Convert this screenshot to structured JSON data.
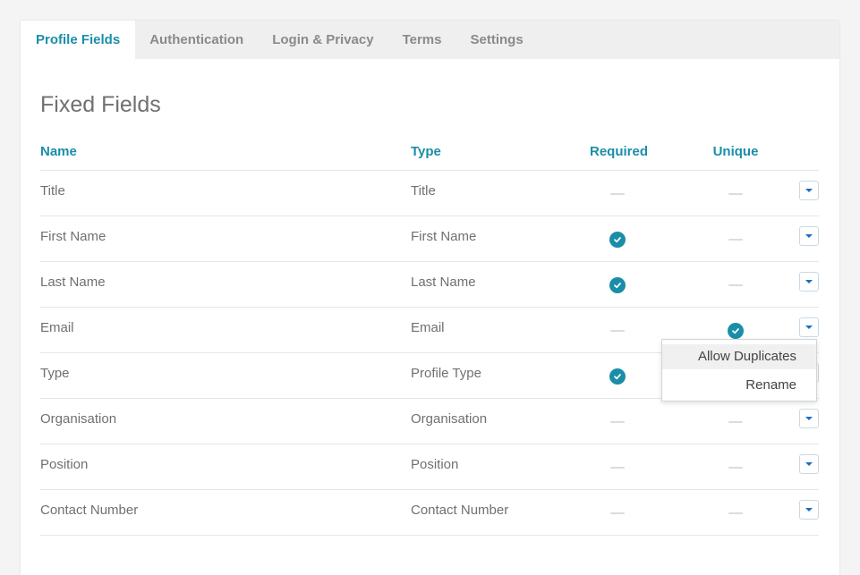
{
  "tabs": [
    {
      "label": "Profile Fields",
      "active": true
    },
    {
      "label": "Authentication",
      "active": false
    },
    {
      "label": "Login & Privacy",
      "active": false
    },
    {
      "label": "Terms",
      "active": false
    },
    {
      "label": "Settings",
      "active": false
    }
  ],
  "section": {
    "title": "Fixed Fields"
  },
  "table": {
    "headers": {
      "name": "Name",
      "type": "Type",
      "required": "Required",
      "unique": "Unique"
    },
    "rows": [
      {
        "name": "Title",
        "type": "Title",
        "required": false,
        "unique": false
      },
      {
        "name": "First Name",
        "type": "First Name",
        "required": true,
        "unique": false
      },
      {
        "name": "Last Name",
        "type": "Last Name",
        "required": true,
        "unique": false
      },
      {
        "name": "Email",
        "type": "Email",
        "required": false,
        "unique": true
      },
      {
        "name": "Type",
        "type": "Profile Type",
        "required": true,
        "unique": false
      },
      {
        "name": "Organisation",
        "type": "Organisation",
        "required": false,
        "unique": false
      },
      {
        "name": "Position",
        "type": "Position",
        "required": false,
        "unique": false
      },
      {
        "name": "Contact Number",
        "type": "Contact Number",
        "required": false,
        "unique": false
      }
    ]
  },
  "dropdown": {
    "open_for_row": 3,
    "items": [
      {
        "label": "Allow Duplicates",
        "hover": true
      },
      {
        "label": "Rename",
        "hover": false
      }
    ]
  },
  "icons": {
    "check": "check-circle-icon",
    "empty": "dash-icon",
    "row_menu": "caret-down-icon"
  },
  "colors": {
    "accent": "#1a8ea8",
    "muted_text": "#707070",
    "tab_inactive": "#8a8a8a",
    "tabbar_bg": "#efefef",
    "divider": "#e6e6e6",
    "page_bg": "#f4f4f4"
  }
}
